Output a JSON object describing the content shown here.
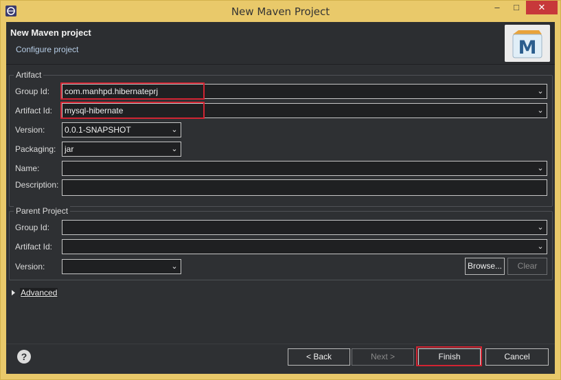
{
  "window": {
    "title": "New Maven Project",
    "controls": {
      "minimize": "–",
      "maximize": "□",
      "close": "✕"
    }
  },
  "banner": {
    "title": "New Maven project",
    "subtitle": "Configure project",
    "logo_letter": "M"
  },
  "artifact": {
    "legend": "Artifact",
    "group_id_label": "Group Id:",
    "group_id_value": "com.manhpd.hibernateprj",
    "artifact_id_label": "Artifact Id:",
    "artifact_id_value": "mysql-hibernate",
    "version_label": "Version:",
    "version_value": "0.0.1-SNAPSHOT",
    "packaging_label": "Packaging:",
    "packaging_value": "jar",
    "name_label": "Name:",
    "name_value": "",
    "description_label": "Description:",
    "description_value": ""
  },
  "parent": {
    "legend": "Parent Project",
    "group_id_label": "Group Id:",
    "group_id_value": "",
    "artifact_id_label": "Artifact Id:",
    "artifact_id_value": "",
    "version_label": "Version:",
    "version_value": "",
    "browse_label": "Browse...",
    "clear_label": "Clear"
  },
  "advanced": {
    "label": "Advanced"
  },
  "footer": {
    "help_icon": "?",
    "back_label": "< Back",
    "next_label": "Next >",
    "finish_label": "Finish",
    "cancel_label": "Cancel"
  },
  "icons": {
    "dropdown_arrow": "chevron-down-icon",
    "help": "help-icon",
    "expand": "triangle-right-icon"
  },
  "colors": {
    "titlebar": "#e9c96a",
    "dialog_bg": "#2e3033",
    "highlight": "#d22432",
    "link": "#b6cde6"
  }
}
